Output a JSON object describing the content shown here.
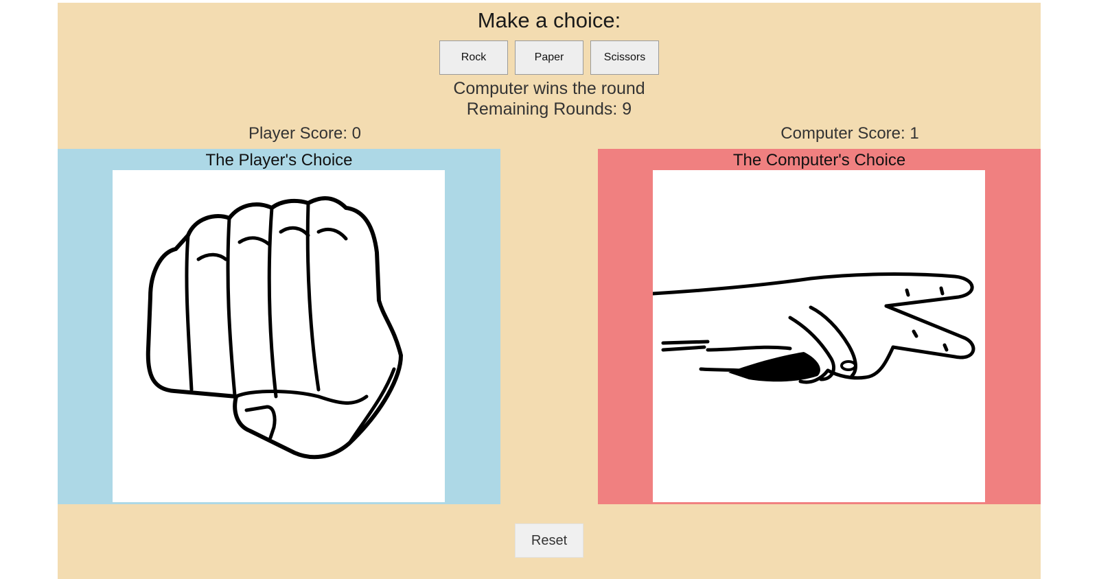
{
  "header": {
    "title": "Make a choice:"
  },
  "choices": {
    "rock": "Rock",
    "paper": "Paper",
    "scissors": "Scissors"
  },
  "status": {
    "round_result": "Computer wins the round",
    "remaining": "Remaining Rounds: 9"
  },
  "scores": {
    "player": "Player Score: 0",
    "computer": "Computer Score: 1"
  },
  "player_panel": {
    "title": "The Player's Choice",
    "image": "fist-icon"
  },
  "computer_panel": {
    "title": "The Computer's Choice",
    "image": "scissors-hand-icon"
  },
  "controls": {
    "reset": "Reset"
  },
  "colors": {
    "background": "#f3dcb1",
    "player_panel": "#add8e6",
    "computer_panel": "#f08080"
  }
}
